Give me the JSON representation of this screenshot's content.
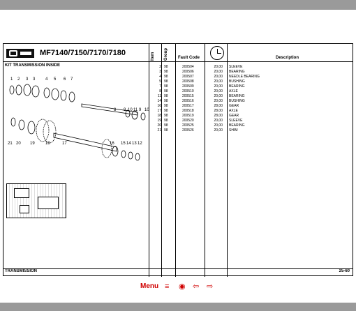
{
  "header": {
    "model": "MF7140/7150/7170/7180",
    "col_item": "Item",
    "col_group": "Group",
    "col_code": "Fault Code",
    "col_desc": "Description"
  },
  "section": {
    "title": "KIT TRANSMISSION INSIDE"
  },
  "rows": [
    {
      "item": "2",
      "group": "98",
      "code": "200504",
      "time": "20,00",
      "desc": "SLEEVE"
    },
    {
      "item": "3",
      "group": "98",
      "code": "200506",
      "time": "20,00",
      "desc": "BEARING"
    },
    {
      "item": "4",
      "group": "98",
      "code": "200507",
      "time": "20,00",
      "desc": "NEEDLE BEARING"
    },
    {
      "item": "5",
      "group": "98",
      "code": "200508",
      "time": "20,00",
      "desc": "BUSHING"
    },
    {
      "item": "7",
      "group": "98",
      "code": "200509",
      "time": "20,00",
      "desc": "BEARING"
    },
    {
      "item": "8",
      "group": "98",
      "code": "200510",
      "time": "20,00",
      "desc": "AXLE"
    },
    {
      "item": "11",
      "group": "98",
      "code": "200515",
      "time": "20,00",
      "desc": "BEARING"
    },
    {
      "item": "14",
      "group": "98",
      "code": "200516",
      "time": "20,00",
      "desc": "BUSHING"
    },
    {
      "item": "16",
      "group": "98",
      "code": "200517",
      "time": "28,00",
      "desc": "GEAR"
    },
    {
      "item": "17",
      "group": "98",
      "code": "200518",
      "time": "28,00",
      "desc": "AXLE"
    },
    {
      "item": "18",
      "group": "98",
      "code": "200519",
      "time": "28,00",
      "desc": "GEAR"
    },
    {
      "item": "19",
      "group": "98",
      "code": "200520",
      "time": "20,00",
      "desc": "SLEEVE"
    },
    {
      "item": "20",
      "group": "98",
      "code": "200525",
      "time": "20,00",
      "desc": "BEARING"
    },
    {
      "item": "21",
      "group": "98",
      "code": "200526",
      "time": "20,00",
      "desc": "SHIM"
    }
  ],
  "diagram": {
    "callouts_top": [
      "1",
      "2",
      "3",
      "3",
      "4",
      "5",
      "6",
      "7"
    ],
    "callouts_right": [
      "8",
      "9",
      "10",
      "11",
      "9",
      "10"
    ],
    "callouts_bottom": [
      "21",
      "20",
      "19",
      "18",
      "17",
      "16",
      "15",
      "14",
      "13",
      "12"
    ]
  },
  "footer": {
    "left": "TRANSMISSION",
    "right": "25-60"
  },
  "nav": {
    "menu": "Menu",
    "icons": [
      "list-icon",
      "view-icon",
      "back-arrow-icon",
      "forward-arrow-icon"
    ],
    "color": "#d00000"
  }
}
